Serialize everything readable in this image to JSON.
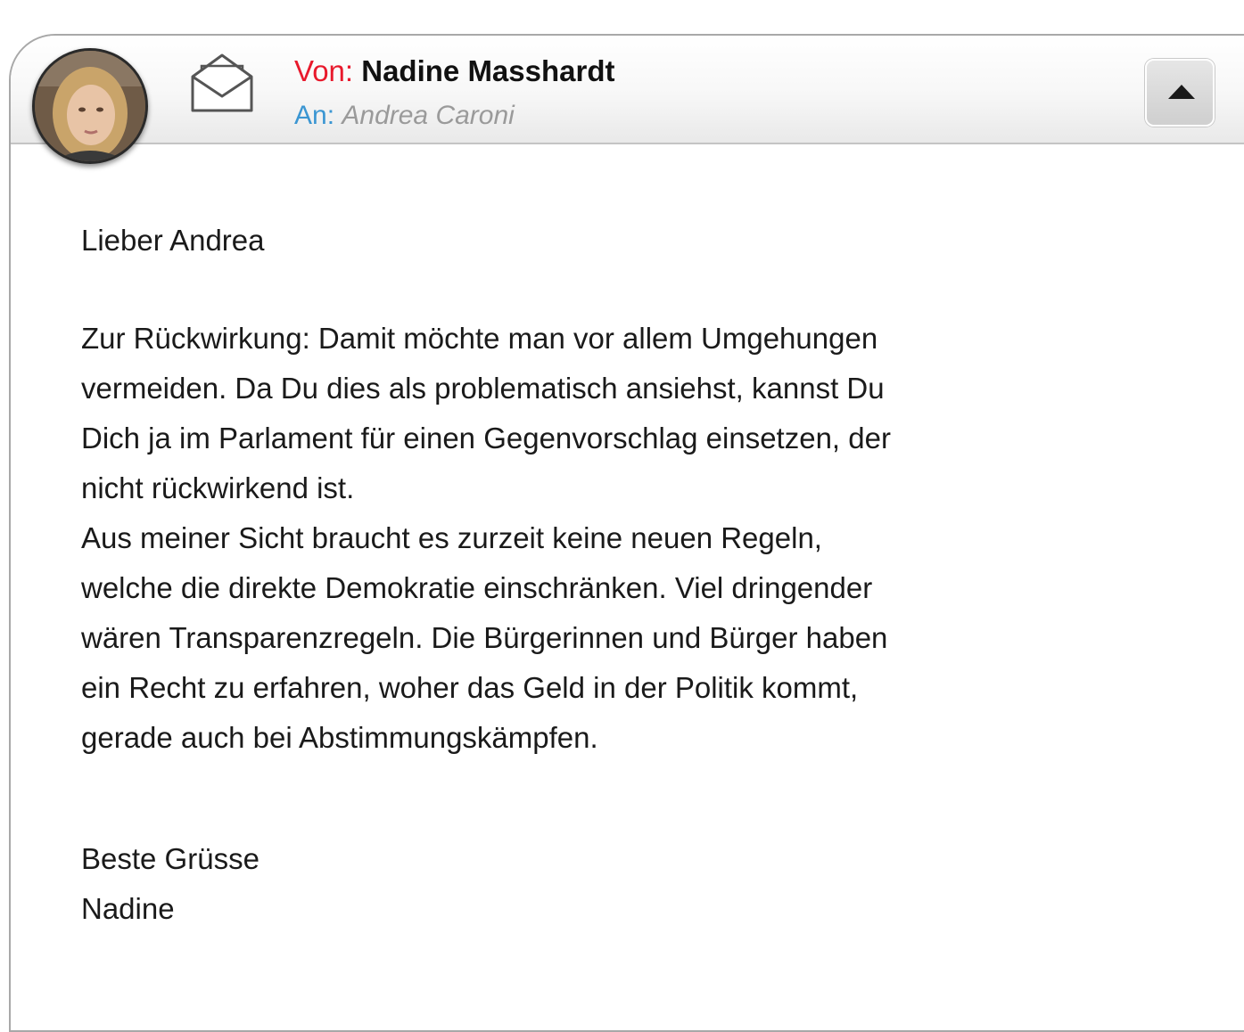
{
  "header": {
    "from_label": "Von:",
    "from_name": "Nadine Masshardt",
    "to_label": "An:",
    "to_name": "Andrea Caroni",
    "avatar_icon": "sender-avatar",
    "mail_icon": "open-envelope-icon",
    "collapse_icon": "triangle-up-icon"
  },
  "message": {
    "greeting": "Lieber Andrea",
    "lines": [
      "Zur Rückwirkung: Damit möchte man vor allem Umgehungen",
      "vermeiden. Da Du dies als problematisch ansiehst, kannst Du",
      "Dich ja im Parlament für einen Gegenvorschlag einsetzen, der",
      "nicht rückwirkend ist.",
      "Aus meiner Sicht braucht es zurzeit keine neuen Regeln,",
      "welche die direkte Demokratie einschränken. Viel dringender",
      "wären Transparenzregeln. Die Bürgerinnen und Bürger haben",
      "ein Recht zu erfahren, woher das Geld in der Politik kommt,",
      "gerade auch bei Abstimmungskämpfen."
    ],
    "closing": "Beste Grüsse",
    "signature": "Nadine"
  },
  "colors": {
    "from_label": "#e8192c",
    "to_label": "#3b96d2",
    "to_name": "#9a9a9a"
  }
}
